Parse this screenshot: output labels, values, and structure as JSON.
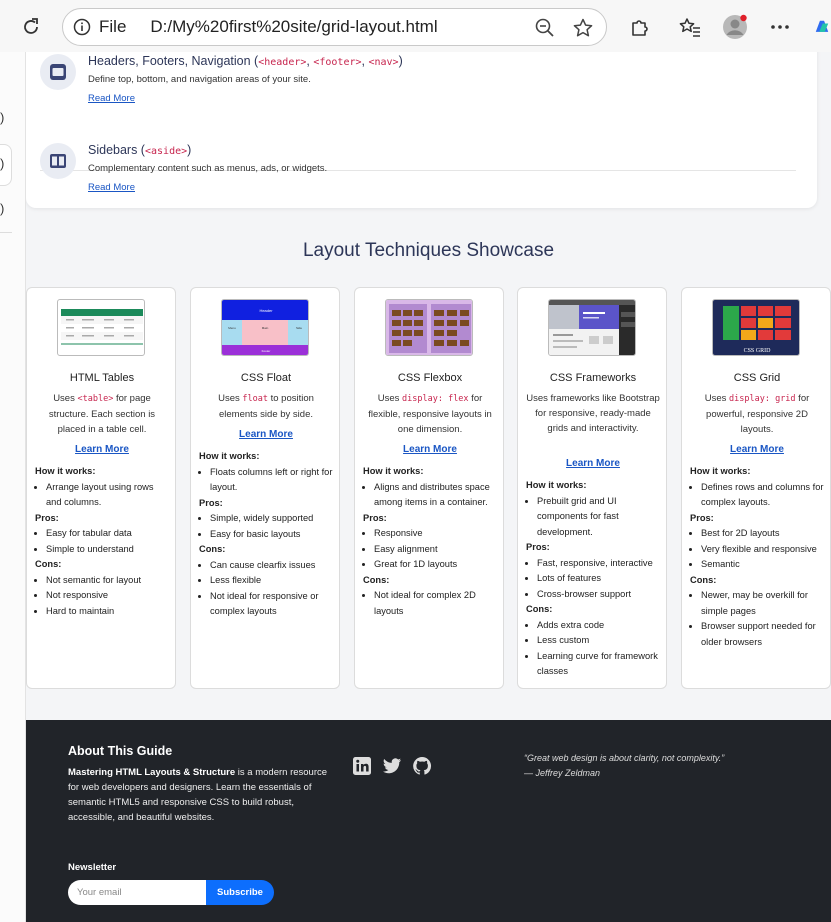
{
  "browser": {
    "scheme_label": "File",
    "url": "D:/My%20first%20site/grid-layout.html"
  },
  "structure": {
    "items": [
      {
        "title": "Headers, Footers, Navigation (",
        "tags": [
          "<header>",
          "<footer>",
          "<nav>"
        ],
        "description": "Define top, bottom, and navigation areas of your site.",
        "link": "Read More"
      },
      {
        "title": "Sidebars (",
        "tags": [
          "<aside>"
        ],
        "description": "Complementary content such as menus, ads, or widgets.",
        "link": "Read More"
      }
    ]
  },
  "showcase": {
    "title": "Layout Techniques Showcase",
    "cards": [
      {
        "title": "HTML Tables",
        "desc_pre": "Uses ",
        "desc_code": "<table>",
        "desc_post": " for page structure. Each section is placed in a table cell.",
        "link": "Learn More",
        "how_label": "How it works:",
        "how": [
          "Arrange layout using rows and columns."
        ],
        "pros_label": "Pros:",
        "pros": [
          "Easy for tabular data",
          "Simple to understand"
        ],
        "cons_label": "Cons:",
        "cons": [
          "Not semantic for layout",
          "Not responsive",
          "Hard to maintain"
        ]
      },
      {
        "title": "CSS Float",
        "desc_pre": "Uses ",
        "desc_code": "float",
        "desc_post": " to position elements side by side.",
        "link": "Learn More",
        "how_label": "How it works:",
        "how": [
          "Floats columns left or right for layout."
        ],
        "pros_label": "Pros:",
        "pros": [
          "Simple, widely supported",
          "Easy for basic layouts"
        ],
        "cons_label": "Cons:",
        "cons": [
          "Can cause clearfix issues",
          "Less flexible",
          "Not ideal for responsive or complex layouts"
        ]
      },
      {
        "title": "CSS Flexbox",
        "desc_pre": "Uses ",
        "desc_code": "display: flex",
        "desc_post": " for flexible, responsive layouts in one dimension.",
        "link": "Learn More",
        "how_label": "How it works:",
        "how": [
          "Aligns and distributes space among items in a container."
        ],
        "pros_label": "Pros:",
        "pros": [
          "Responsive",
          "Easy alignment",
          "Great for 1D layouts"
        ],
        "cons_label": "Cons:",
        "cons": [
          "Not ideal for complex 2D layouts"
        ]
      },
      {
        "title": "CSS Frameworks",
        "desc_pre": "Uses frameworks like Bootstrap for responsive, ready-made grids and interactivity.",
        "desc_code": "",
        "desc_post": "",
        "link": "Learn More",
        "how_label": "How it works:",
        "how": [
          "Prebuilt grid and UI components for fast development."
        ],
        "pros_label": "Pros:",
        "pros": [
          "Fast, responsive, interactive",
          "Lots of features",
          "Cross-browser support"
        ],
        "cons_label": "Cons:",
        "cons": [
          "Adds extra code",
          "Less custom",
          "Learning curve for framework classes"
        ]
      },
      {
        "title": "CSS Grid",
        "desc_pre": "Uses ",
        "desc_code": "display: grid",
        "desc_post": " for powerful, responsive 2D layouts.",
        "link": "Learn More",
        "how_label": "How it works:",
        "how": [
          "Defines rows and columns for complex layouts."
        ],
        "pros_label": "Pros:",
        "pros": [
          "Best for 2D layouts",
          "Very flexible and responsive",
          "Semantic"
        ],
        "cons_label": "Cons:",
        "cons": [
          "Newer, may be overkill for simple pages",
          "Browser support needed for older browsers"
        ]
      }
    ],
    "thumb_texts": {
      "float_header": "Header",
      "float_menu": "Menu",
      "float_main": "Main",
      "float_side": "Side",
      "float_footer": "Footer",
      "grid_caption": "CSS GRID"
    }
  },
  "footer": {
    "title": "About This Guide",
    "text_bold": "Mastering HTML Layouts & Structure",
    "text_rest": " is a modern resource for web developers and designers. Learn the essentials of semantic HTML5 and responsive CSS to build robust, accessible, and beautiful websites.",
    "quote": "“Great web design is about clarity, not complexity.”",
    "quote_author": "— Jeffrey Zeldman",
    "newsletter_title": "Newsletter",
    "newsletter_placeholder": "Your email",
    "subscribe_label": "Subscribe"
  },
  "icons": {
    "reload": "reload-icon",
    "info": "info-icon",
    "zoom": "zoom-out-icon",
    "favorite": "star-icon",
    "extensions": "puzzle-icon",
    "favorites": "favorites-icon",
    "profile": "avatar-icon",
    "menu": "more-icon",
    "social": [
      "linkedin-icon",
      "twitter-icon",
      "github-icon"
    ]
  },
  "colors": {
    "link": "#1a56c4",
    "code": "#c7254e",
    "heading": "#2d3658",
    "footer_bg": "#212429",
    "subscribe": "#0d6efd"
  }
}
